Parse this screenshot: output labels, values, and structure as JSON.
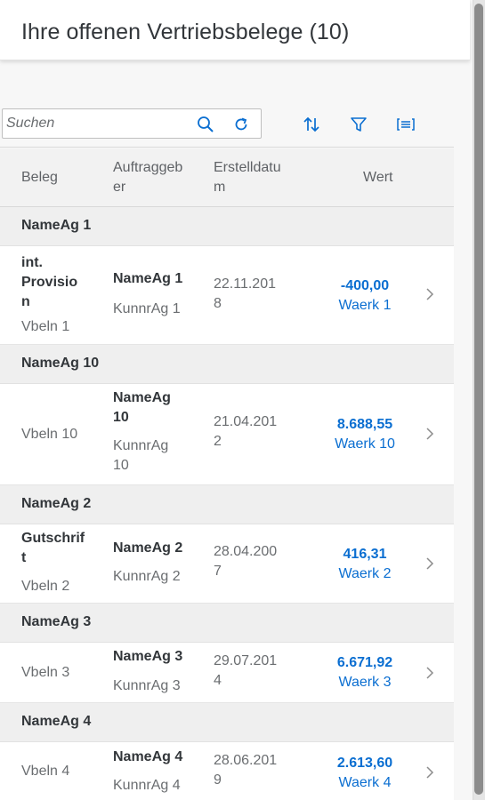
{
  "header": {
    "title": "Ihre offenen Vertriebsbelege (10)"
  },
  "search": {
    "placeholder": "Suchen"
  },
  "columns": [
    "Beleg",
    "Auftraggeb\ner",
    "Erstelldatu\nm",
    "Wert"
  ],
  "groups": [
    {
      "name": "NameAg 1",
      "row": {
        "beleg_title": "int.\nProvisio\nn",
        "vbeln": "Vbeln 1",
        "auftraggeber": "NameAg 1",
        "kunnr": "KunnrAg 1",
        "datum": "22.11.201\n8",
        "wert": "-400,00",
        "waehrung": "Waerk 1"
      }
    },
    {
      "name": "NameAg 10",
      "row": {
        "beleg_title": "",
        "vbeln": "Vbeln 10",
        "auftraggeber": "NameAg\n10",
        "kunnr": "KunnrAg\n10",
        "datum": "21.04.201\n2",
        "wert": "8.688,55",
        "waehrung": "Waerk 10"
      }
    },
    {
      "name": "NameAg 2",
      "row": {
        "beleg_title": "Gutschrif\nt",
        "vbeln": "Vbeln 2",
        "auftraggeber": "NameAg 2",
        "kunnr": "KunnrAg 2",
        "datum": "28.04.200\n7",
        "wert": "416,31",
        "waehrung": "Waerk 2"
      }
    },
    {
      "name": "NameAg 3",
      "row": {
        "beleg_title": "",
        "vbeln": "Vbeln 3",
        "auftraggeber": "NameAg 3",
        "kunnr": "KunnrAg 3",
        "datum": "29.07.201\n4",
        "wert": "6.671,92",
        "waehrung": "Waerk 3"
      }
    },
    {
      "name": "NameAg 4",
      "row": {
        "beleg_title": "",
        "vbeln": "Vbeln 4",
        "auftraggeber": "NameAg 4",
        "kunnr": "KunnrAg 4",
        "datum": "28.06.201\n9",
        "wert": "2.613,60",
        "waehrung": "Waerk 4"
      }
    }
  ],
  "colors": {
    "accent": "#0a6ed1",
    "text": "#32363a",
    "muted": "#6a6d70",
    "group_bg": "#efefef"
  },
  "icons": [
    "search-icon",
    "refresh-icon",
    "sort-icon",
    "filter-icon",
    "group-icon",
    "chevron-right-icon"
  ]
}
